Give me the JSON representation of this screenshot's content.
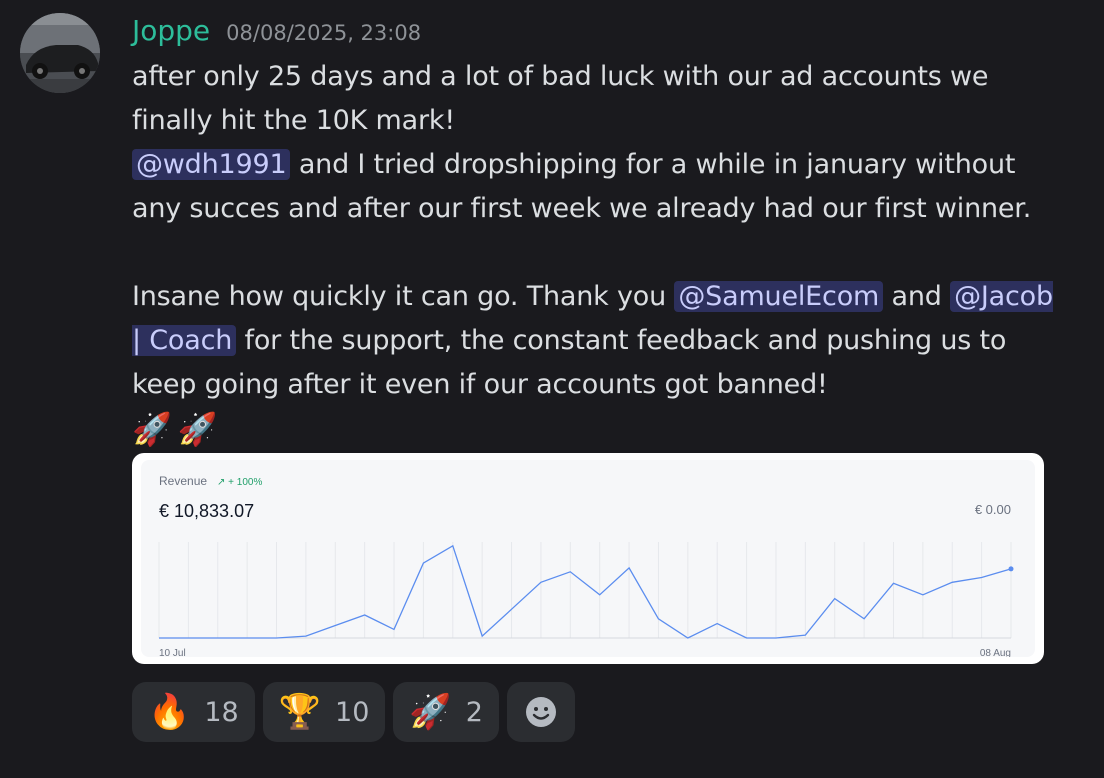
{
  "message": {
    "username": "Joppe",
    "timestamp": "08/08/2025, 23:08",
    "line1": "after only 25 days and a lot of bad luck with our ad accounts we finally hit the 10K mark!",
    "mention1": "@wdh1991",
    "line2": " and I tried dropshipping for a while in january without any succes and after our first week we already had our first winner.",
    "line3a": "Insane how quickly it can go. Thank you ",
    "mention2": "@SamuelEcom",
    "line3b": " and ",
    "mention3": "@Jacob | Coach",
    "line3c": "  for the support, the constant feedback and pushing us to keep going after it even if our accounts got banned!",
    "emojis": [
      "🚀",
      "🚀"
    ]
  },
  "chart_data": {
    "type": "line",
    "title": "Revenue",
    "change": "↗ + 100%",
    "total": "€ 10,833.07",
    "right_value": "€ 0.00",
    "x_start_label": "10 Jul",
    "x_end_label": "08 Aug",
    "x": [
      "10 Jul",
      "11 Jul",
      "12 Jul",
      "13 Jul",
      "14 Jul",
      "15 Jul",
      "16 Jul",
      "17 Jul",
      "18 Jul",
      "19 Jul",
      "20 Jul",
      "21 Jul",
      "22 Jul",
      "23 Jul",
      "24 Jul",
      "25 Jul",
      "26 Jul",
      "27 Jul",
      "28 Jul",
      "29 Jul",
      "30 Jul",
      "31 Jul",
      "01 Aug",
      "02 Aug",
      "03 Aug",
      "04 Aug",
      "05 Aug",
      "06 Aug",
      "07 Aug",
      "08 Aug"
    ],
    "values": [
      0,
      0,
      0,
      0,
      0,
      20,
      130,
      240,
      90,
      780,
      960,
      20,
      300,
      580,
      690,
      450,
      730,
      200,
      0,
      150,
      0,
      0,
      30,
      410,
      200,
      570,
      450,
      580,
      630,
      720
    ],
    "ylim": [
      0,
      1000
    ],
    "line_color": "#5b8def",
    "grid": true
  },
  "reactions": [
    {
      "emoji": "🔥",
      "count": "18"
    },
    {
      "emoji": "🏆",
      "count": "10"
    },
    {
      "emoji": "🚀",
      "count": "2"
    }
  ],
  "add_reaction_icon": "smiley-face-icon"
}
